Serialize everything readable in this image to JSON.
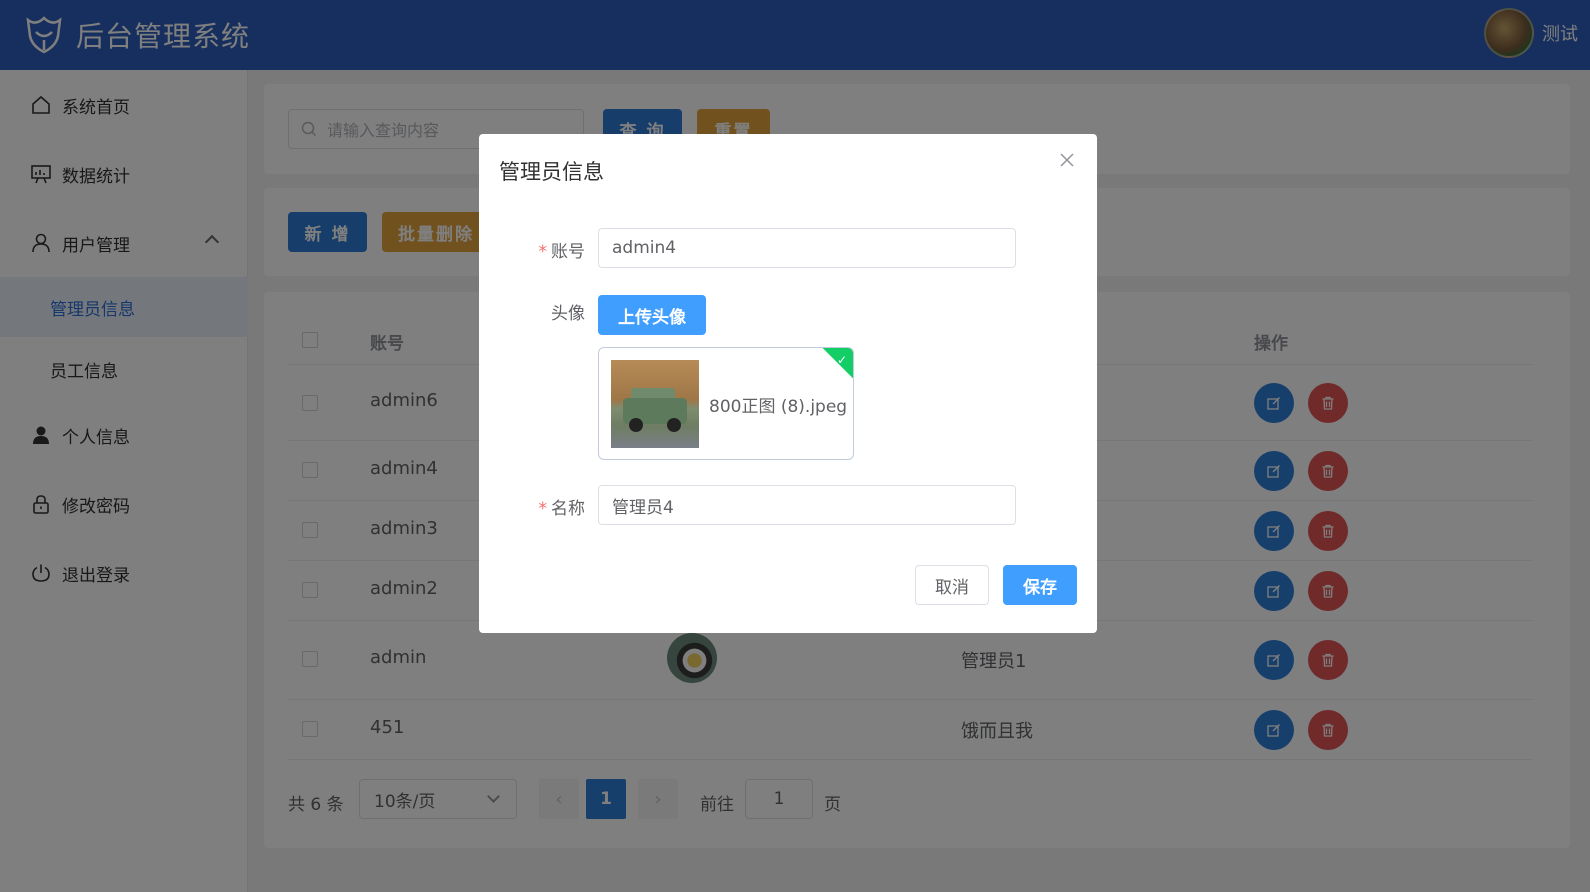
{
  "header": {
    "title": "后台管理系统",
    "user_name": "测试"
  },
  "sidebar": {
    "items": [
      {
        "label": "系统首页",
        "icon": "home-icon"
      },
      {
        "label": "数据统计",
        "icon": "chart-board-icon"
      },
      {
        "label": "用户管理",
        "icon": "user-icon",
        "expanded": true
      },
      {
        "label": "管理员信息",
        "active": true
      },
      {
        "label": "员工信息"
      },
      {
        "label": "个人信息",
        "icon": "person-icon"
      },
      {
        "label": "修改密码",
        "icon": "lock-icon"
      },
      {
        "label": "退出登录",
        "icon": "power-icon"
      }
    ]
  },
  "search": {
    "placeholder": "请输入查询内容",
    "query_label": "查 询",
    "reset_label": "重置"
  },
  "actions": {
    "add_label": "新 增",
    "batch_delete_label": "批量删除"
  },
  "table": {
    "headers": {
      "account": "账号",
      "operation": "操作"
    },
    "rows": [
      {
        "account": "admin6",
        "name": ""
      },
      {
        "account": "admin4",
        "name": ""
      },
      {
        "account": "admin3",
        "name": ""
      },
      {
        "account": "admin2",
        "name": ""
      },
      {
        "account": "admin",
        "name": "管理员1",
        "has_avatar": true
      },
      {
        "account": "451",
        "name": "饿而且我"
      }
    ]
  },
  "pagination": {
    "total_text": "共 6 条",
    "page_size": "10条/页",
    "current_page": "1",
    "goto_label": "前往",
    "goto_value": "1",
    "page_suffix": "页"
  },
  "dialog": {
    "title": "管理员信息",
    "account_label": "账号",
    "account_value": "admin4",
    "avatar_label": "头像",
    "upload_label": "上传头像",
    "file_name": "800正图 (8).jpeg",
    "name_label": "名称",
    "name_value": "管理员4",
    "cancel_label": "取消",
    "save_label": "保存"
  },
  "colors": {
    "header_bg": "#2d5fbd",
    "primary": "#2f7fd9",
    "warning": "#e3a33b",
    "danger": "#e05454",
    "success": "#13ce66"
  }
}
